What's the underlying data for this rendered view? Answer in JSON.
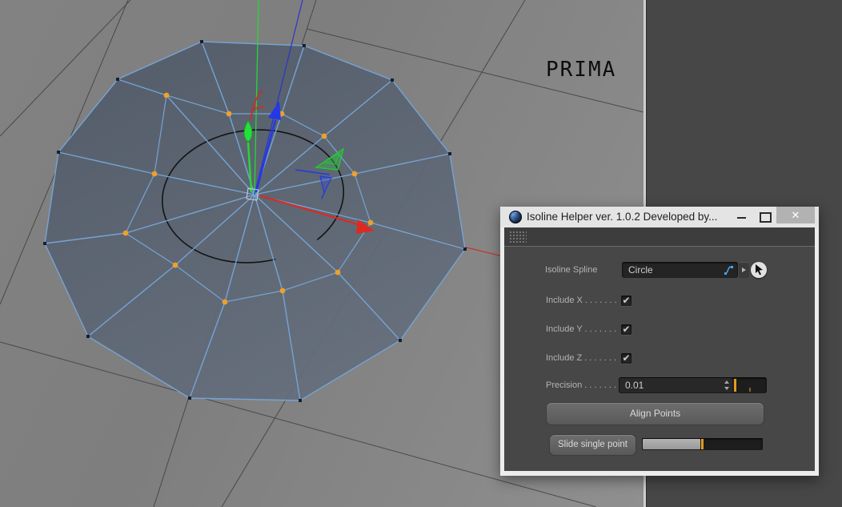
{
  "viewport": {
    "label": "PRIMA",
    "colors": {
      "background": "#858585",
      "mesh_fill": "#57616e",
      "mesh_edge": "#76a3d6",
      "selected_point": "#f0a028",
      "unselected_point": "#16202e",
      "axis_x": "#dd2a20",
      "axis_y": "#25d836",
      "axis_z": "#2438e8",
      "circle_spline": "#141414",
      "grid_line": "#3f3f3f"
    }
  },
  "side_panel": {
    "background": "#474747"
  },
  "dialog": {
    "title": "Isoline Helper ver. 1.0.2 Developed by...",
    "window_controls": {
      "close_glyph": "✕"
    },
    "rows": {
      "isoline_spline": {
        "label": "Isoline Spline",
        "value": "Circle"
      },
      "include_x": {
        "label": "Include X . . . . . . .",
        "checked": true,
        "check_glyph": "✔"
      },
      "include_y": {
        "label": "Include Y . . . . . . .",
        "checked": true,
        "check_glyph": "✔"
      },
      "include_z": {
        "label": "Include Z . . . . . . .",
        "checked": true,
        "check_glyph": "✔"
      },
      "precision": {
        "label": "Precision . . . . . . .",
        "value": "0.01",
        "slider_handle_pct": 0
      },
      "align_button_label": "Align Points",
      "slide_button_label": "Slide single point",
      "slide_slider_fill_pct": 48
    },
    "accent_color": "#e39b1e"
  }
}
